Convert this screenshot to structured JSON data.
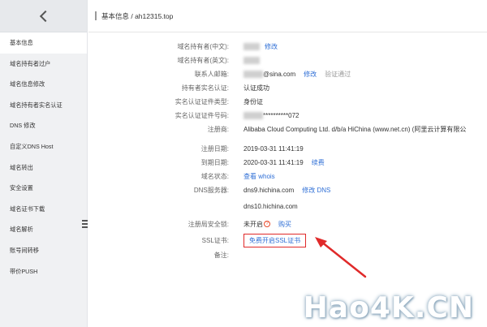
{
  "sidebar": {
    "items": [
      {
        "label": "基本信息",
        "active": true
      },
      {
        "label": "域名持有者过户"
      },
      {
        "label": "域名信息修改"
      },
      {
        "label": "域名持有者实名认证"
      },
      {
        "label": "DNS 修改"
      },
      {
        "label": "自定义DNS Host"
      },
      {
        "label": "域名转出"
      },
      {
        "label": "安全设置"
      },
      {
        "label": "域名证书下载"
      },
      {
        "label": "域名解析"
      },
      {
        "label": "账号间转移"
      },
      {
        "label": "带价PUSH"
      }
    ]
  },
  "breadcrumb": "基本信息 / ah12315.top",
  "fields": {
    "holder_cn": {
      "label": "域名持有者(中文):",
      "action": "修改"
    },
    "holder_en": {
      "label": "域名持有者(英文):"
    },
    "email": {
      "label": "联系人邮箱:",
      "value": "@sina.com",
      "action": "修改",
      "status": "验证通过"
    },
    "realname": {
      "label": "持有者实名认证:",
      "value": "认证成功"
    },
    "id_type": {
      "label": "实名认证证件类型:",
      "value": "身份证"
    },
    "id_number": {
      "label": "实名认证证件号码:",
      "value": "**********072"
    },
    "registrar": {
      "label": "注册商:",
      "value": "Alibaba Cloud Computing Ltd. d/b/a HiChina (www.net.cn) (阿里云计算有限公"
    },
    "reg_date": {
      "label": "注册日期:",
      "value": "2019-03-31 11:41:19"
    },
    "exp_date": {
      "label": "到期日期:",
      "value": "2020-03-31 11:41:19",
      "action": "续费"
    },
    "domain_status": {
      "label": "域名状态:",
      "action": "查看 whois"
    },
    "dns": {
      "label": "DNS服务器:",
      "value1": "dns9.hichina.com",
      "action": "修改 DNS",
      "value2": "dns10.hichina.com"
    },
    "registry_lock": {
      "label": "注册局安全锁:",
      "value": "未开启",
      "action": "购买"
    },
    "ssl": {
      "label": "SSL证书:",
      "action": "免费开启SSL证书"
    },
    "note": {
      "label": "备注:"
    }
  },
  "watermark": "Hao4K.CN",
  "colors": {
    "link": "#2f6fd6",
    "highlight": "#e02a2a",
    "sidebar_bg": "#f0f1f3"
  }
}
